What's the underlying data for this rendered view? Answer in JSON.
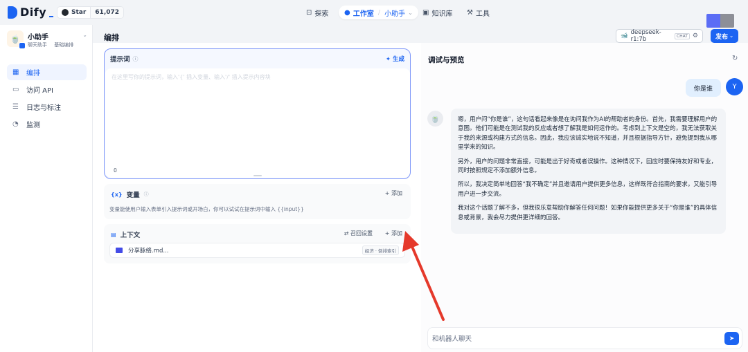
{
  "brand": {
    "name": "Dify"
  },
  "github": {
    "label": "Star",
    "count": "61,072"
  },
  "nav": {
    "explore": "探索",
    "studio": "工作室",
    "current_app": "小助手",
    "knowledge": "知识库",
    "tools": "工具"
  },
  "app": {
    "name": "小助手",
    "type": "聊天助手",
    "mode": "基础编排"
  },
  "sidebar": {
    "items": [
      {
        "label": "编排",
        "icon": "edit-icon"
      },
      {
        "label": "访问 API",
        "icon": "terminal-icon"
      },
      {
        "label": "日志与标注",
        "icon": "file-list-icon"
      },
      {
        "label": "监测",
        "icon": "monitor-icon"
      }
    ]
  },
  "editor": {
    "title": "编排",
    "model_name": "deepseek-r1:7b",
    "model_tag": "CHAT",
    "publish": "发布",
    "prompt": {
      "label": "提示词",
      "generate": "生成",
      "placeholder": "在这里写你的提示词，输入'{' 插入变量、输入'/' 插入提示内容块",
      "count": "0"
    },
    "variables": {
      "label": "变量",
      "add": "添加",
      "desc": "变量能使用户输入表单引入提示词或开场白，你可以试试在提示词中输入 {{input}}"
    },
    "context": {
      "label": "上下文",
      "recall": "召回设置",
      "add": "添加",
      "item_name": "分享脉络.md...",
      "item_tag": "经济 · 倒排索引"
    }
  },
  "preview": {
    "title": "调试与预览",
    "user_message": "你是谁",
    "user_initial": "Y",
    "bot_paragraphs": [
      "嗯，用户问“你是谁”，这句话看起来像是在询问我作为AI的帮助者的身份。首先，我需要理解用户的意图。他们可能是在测试我的反应或者想了解我是如何运作的。考虑到上下文是空的，我无法获取关于我的来源或构建方式的信息。因此，我应该诚实地说不知道，并且根据指导方针，避免提到我从哪里学来的知识。",
      "另外，用户的问题非常直接，可能是出于好奇或者误操作。这种情况下，回应时要保持友好和专业，同时按照规定不添加额外信息。",
      "所以，我决定简单地回答“我不确定”并且邀请用户提供更多信息，这样既符合指南的要求，又能引导用户进一步交流。",
      "我对这个话题了解不多，但我很乐意帮助你解答任何问题！如果你能提供更多关于“你是谁”的具体信息或背景，我会尽力提供更详细的回答。"
    ],
    "input_placeholder": "和机器人聊天"
  },
  "colors": {
    "accent": "#1c64f2",
    "annotation_arrow": "#e5392b"
  }
}
